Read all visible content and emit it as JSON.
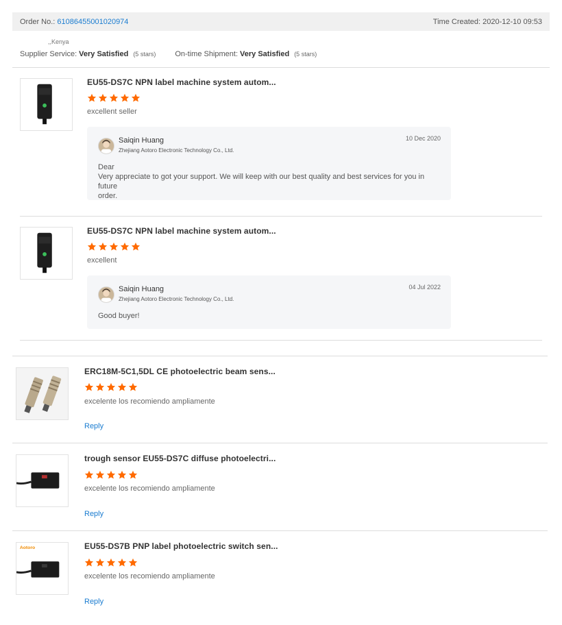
{
  "order": {
    "order_no_label": "Order No.:",
    "order_no_value": "61086455001020974",
    "time_created_label": "Time Created:",
    "time_created_value": "2020-12-10 09:53",
    "country": ",,Kenya"
  },
  "ratings": {
    "supplier_service_label": "Supplier Service:",
    "supplier_service_value": "Very Satisfied",
    "supplier_service_stars": "(5 stars)",
    "shipment_label": "On-time Shipment:",
    "shipment_value": "Very Satisfied",
    "shipment_stars": "(5 stars)"
  },
  "colors": {
    "star": "#ff6a00",
    "link": "#1a7cd0"
  },
  "reviews": [
    {
      "title": "EU55-DS7C NPN label machine system autom...",
      "rating": 5,
      "comment": "excellent seller",
      "product_image": "black-sensor-icon",
      "reply": {
        "name": "Saiqin Huang",
        "company": "Zhejiang Aotoro Electronic Technology Co., Ltd.",
        "date": "10 Dec 2020",
        "line1": "Dear",
        "line2": "Very appreciate to got your support. We will keep with our best quality and best services for you in future",
        "line3": "order."
      }
    },
    {
      "title": "EU55-DS7C NPN label machine system autom...",
      "rating": 5,
      "comment": "excellent",
      "product_image": "black-sensor-icon",
      "reply": {
        "name": "Saiqin Huang",
        "company": "Zhejiang Aotoro Electronic Technology Co., Ltd.",
        "date": "04 Jul 2022",
        "line1": "Good buyer!"
      }
    },
    {
      "title": "ERC18M-5C1,5DL CE photoelectric beam sens...",
      "rating": 5,
      "comment": "excelente los recomiendo ampliamente",
      "reply_label": "Reply",
      "product_image": "cylindrical-sensor-icon"
    },
    {
      "title": "trough sensor EU55-DS7C diffuse photoelectri...",
      "rating": 5,
      "comment": "excelente los recomiendo ampliamente",
      "reply_label": "Reply",
      "product_image": "slot-sensor-icon"
    },
    {
      "title": "EU55-DS7B PNP label photoelectric switch sen...",
      "rating": 5,
      "comment": "excelente los recomiendo ampliamente",
      "reply_label": "Reply",
      "product_image": "slot-sensor-icon",
      "brand": "Aotoro"
    }
  ]
}
